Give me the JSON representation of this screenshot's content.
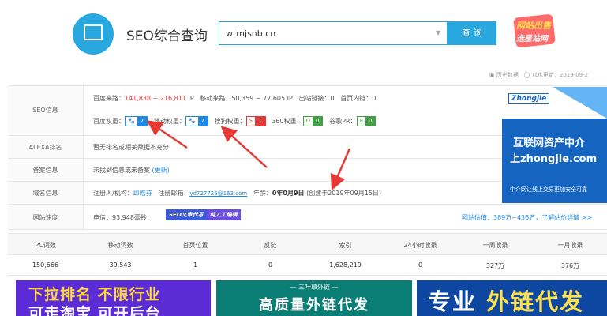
{
  "header": {
    "title": "SEO综合查询",
    "search_value": "wtmjsnb.cn",
    "search_button": "查 询",
    "promo_line1": "网站出售",
    "promo_line2": "选星站网"
  },
  "topbar": {
    "history": "历史数据",
    "tdk": "TDK更新：2019-09-2"
  },
  "seo": {
    "label": "SEO信息",
    "baidu_source_label": "百度来路：",
    "baidu_source_value": "141,838 ~ 216,811",
    "baidu_source_unit": "IP",
    "mobile_source_label": "移动来路：",
    "mobile_source_value": "50,359 ~ 77,605",
    "mobile_source_unit": "IP",
    "outlinks_label": "出站链接：",
    "outlinks_value": "0",
    "homelinks_label": "首页内链：",
    "homelinks_value": "0",
    "baidu_weight_label": "百度权重：",
    "baidu_weight_value": "7",
    "mobile_weight_label": "移动权重：",
    "mobile_weight_value": "7",
    "sogou_weight_label": "搜狗权重：",
    "sogou_weight_value": "1",
    "so360_weight_label": "360权重：",
    "so360_weight_value": "0",
    "google_pr_label": "谷歌PR：",
    "google_pr_value": "0"
  },
  "alexa": {
    "label": "ALEXA排名",
    "value": "暂无排名或相关数据不充分"
  },
  "beian": {
    "label": "备案信息",
    "value": "未找到信息或未备案",
    "link": "(更新)"
  },
  "domain": {
    "label": "域名信息",
    "registrant_label": "注册人/机构：",
    "registrant_value": "邱皓芬",
    "email_label": "注册邮箱：",
    "email_value": "yd727725@163.com",
    "age_label": "年龄：",
    "age_value": "0年0月9日",
    "created": "(创建于2019年09月15日)"
  },
  "speed": {
    "label": "网站速度",
    "value": "电信：93.948毫秒",
    "pill_a": "SEO文章代写",
    "pill_b": "纯人工编辑",
    "valuation": "网站估值：389万~436万，了解估价详情 >>"
  },
  "ad": {
    "logo": "Zhongjie",
    "line1": "互联网资产中介",
    "line2": "上zhongjie.com",
    "line3": "中介网让线上交易更加安全可靠"
  },
  "stats": {
    "headers": [
      "PC词数",
      "移动词数",
      "首页位置",
      "反链",
      "索引",
      "24小时收录",
      "一周收录",
      "一月收录"
    ],
    "values": [
      "150,666",
      "39,543",
      "1",
      "0",
      "1,628,219",
      "0",
      "327万",
      "376万"
    ]
  },
  "banners": {
    "b1_line1": "下拉排名  不限行业",
    "b1_line2": "可走淘宝  可开后台",
    "b2_line1": "— 三叶草外链 —",
    "b2_line2": "高质量外链代发",
    "b3_white": "专业",
    "b3_yellow": "外链代发"
  },
  "colors": {
    "accent": "#29a8e0",
    "red": "#e53935",
    "link": "#1e88e5"
  },
  "icons": [
    "monitor-icon",
    "paw-icon",
    "history-icon",
    "clock-icon"
  ]
}
